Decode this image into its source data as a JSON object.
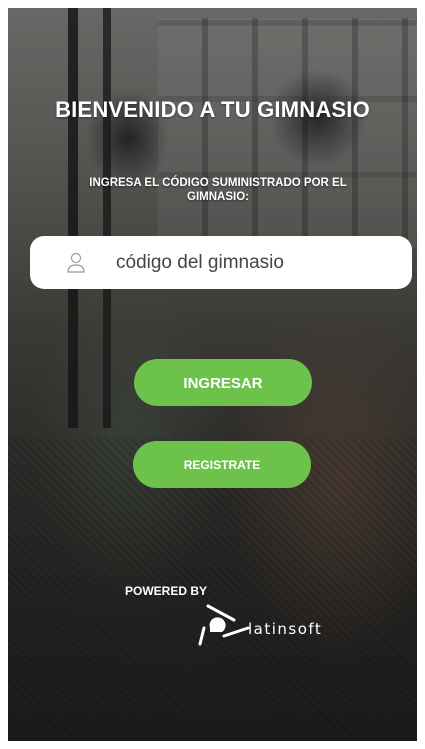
{
  "welcome": {
    "title": "BIENVENIDO A TU GIMNASIO",
    "instruction": "INGRESA EL CÓDIGO SUMINISTRADO POR EL GIMNASIO:"
  },
  "gym_code": {
    "value": "",
    "placeholder": "código del gimnasio",
    "icon": "user-icon"
  },
  "actions": {
    "login_label": "INGRESAR",
    "register_label": "REGISTRATE"
  },
  "footer": {
    "powered_by": "POWERED BY",
    "brand": "latinsoft"
  },
  "colors": {
    "accent": "#6cc24a",
    "text": "#ffffff",
    "input_bg": "#ffffff"
  }
}
